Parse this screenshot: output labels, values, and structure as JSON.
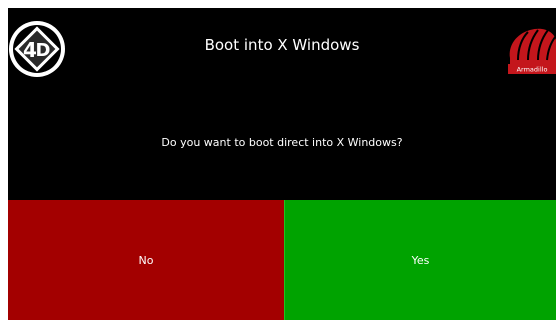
{
  "dialog": {
    "title": "Boot into X Windows",
    "question": "Do you want to boot direct into X Windows?"
  },
  "buttons": {
    "no_label": "No",
    "yes_label": "Yes"
  },
  "logos": {
    "left": "4d-systems-logo",
    "right": "armadillo-logo",
    "right_text": "Armadillo"
  },
  "colors": {
    "background": "#000000",
    "no_button": "#a30000",
    "yes_button": "#00a300",
    "text": "#ffffff",
    "armadillo_red": "#c4161c"
  }
}
